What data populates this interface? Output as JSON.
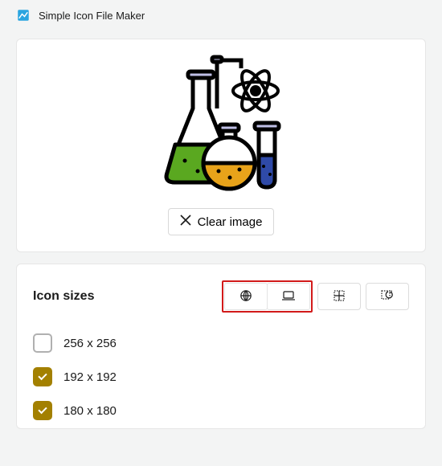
{
  "app": {
    "title": "Simple Icon File Maker"
  },
  "actions": {
    "clear_image": "Clear image"
  },
  "sizes_section": {
    "title": "Icon sizes",
    "buttons": {
      "web": "web-icon",
      "desktop": "desktop-icon",
      "grid": "grid-icon",
      "refresh": "refresh-icon"
    },
    "items": [
      {
        "label": "256 x 256",
        "checked": false
      },
      {
        "label": "192 x 192",
        "checked": true
      },
      {
        "label": "180 x 180",
        "checked": true
      }
    ]
  }
}
